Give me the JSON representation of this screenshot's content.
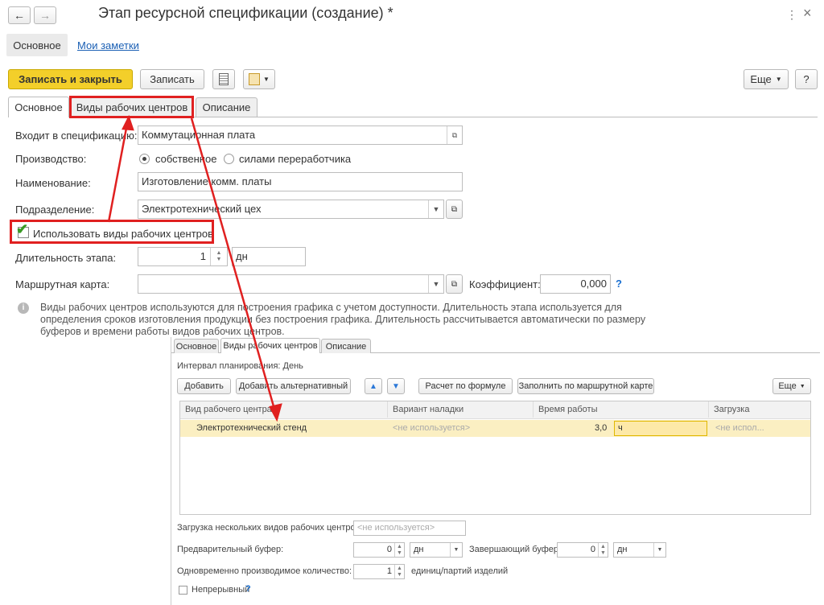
{
  "window": {
    "title": "Этап ресурсной спецификации (создание) *",
    "more_icon": "⋮",
    "close_icon": "×"
  },
  "nav": {
    "main_link": "Основное",
    "notes_link": "Мои заметки"
  },
  "toolbar": {
    "save_close": "Записать и закрыть",
    "save": "Записать",
    "more": "Еще",
    "help": "?"
  },
  "tabs": [
    "Основное",
    "Виды рабочих центров",
    "Описание"
  ],
  "form": {
    "spec_label": "Входит в спецификацию:",
    "spec_value": "Коммутационная плата",
    "prod_label": "Производство:",
    "prod_opt1": "собственное",
    "prod_opt2": "силами переработчика",
    "name_label": "Наименование:",
    "name_value": "Изготовление комм. платы",
    "dept_label": "Подразделение:",
    "dept_value": "Электротехнический цех",
    "use_wc_label": "Использовать виды рабочих центров",
    "use_wc_checked": true,
    "duration_label": "Длительность этапа:",
    "duration_value": "1",
    "duration_unit": "дн",
    "route_label": "Маршрутная карта:",
    "route_value": "",
    "coef_label": "Коэффициент:",
    "coef_value": "0,000",
    "coef_help": "?"
  },
  "info": {
    "line1": "Виды рабочих центров используются для построения графика с учетом доступности. Длительность этапа используется для",
    "line2": "определения сроков изготовления продукции без построения графика. Длительность рассчитывается автоматически по размеру",
    "line3": "буферов и времени работы видов рабочих центров."
  },
  "inner": {
    "tabs": [
      "Основное",
      "Виды рабочих центров",
      "Описание"
    ],
    "interval": "Интервал планирования: День",
    "btn_add": "Добавить",
    "btn_add_alt": "Добавить альтернативный",
    "btn_calc": "Расчет по формуле",
    "btn_fill": "Заполнить по маршрутной карте",
    "btn_more": "Еще",
    "columns": [
      "Вид рабочего центра",
      "Вариант наладки",
      "Время работы",
      "Загрузка"
    ],
    "row": {
      "wc": "Электротехнический стенд",
      "setup": "<не используется>",
      "time": "3,0",
      "unit": "ч",
      "load": "<не испол..."
    },
    "multi_label": "Загрузка нескольких видов рабочих центров:",
    "multi_value": "<не используется>",
    "pre_buf_label": "Предварительный буфер:",
    "pre_buf_value": "0",
    "pre_buf_unit": "дн",
    "post_buf_label": "Завершающий буфер:",
    "post_buf_value": "0",
    "post_buf_unit": "дн",
    "qty_label": "Одновременно производимое количество:",
    "qty_value": "1",
    "qty_unit": "единиц/партий изделий",
    "cont_label": "Непрерывный",
    "cont_help": "?"
  },
  "colors": {
    "accent": "#f3cf2a",
    "highlight": "#e02020",
    "row_bg": "#fbefc2",
    "link": "#1a5fb4"
  }
}
